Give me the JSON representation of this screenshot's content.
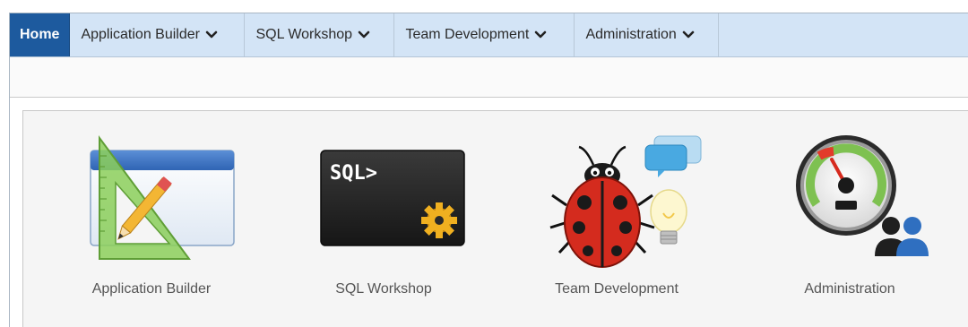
{
  "nav": {
    "items": [
      {
        "label": "Home",
        "active": true
      },
      {
        "label": "Application Builder",
        "dropdown": true
      },
      {
        "label": "SQL Workshop",
        "dropdown": true
      },
      {
        "label": "Team Development",
        "dropdown": true
      },
      {
        "label": "Administration",
        "dropdown": true
      }
    ]
  },
  "tiles": [
    {
      "label": "Application Builder",
      "icon": "application-builder-icon"
    },
    {
      "label": "SQL Workshop",
      "icon": "sql-workshop-icon",
      "icon_text": "SQL>"
    },
    {
      "label": "Team Development",
      "icon": "team-development-icon"
    },
    {
      "label": "Administration",
      "icon": "administration-icon"
    }
  ],
  "colors": {
    "nav_bg": "#d3e4f6",
    "nav_active": "#1d5a9e",
    "panel_bg": "#f5f5f5",
    "label_text": "#555555"
  }
}
